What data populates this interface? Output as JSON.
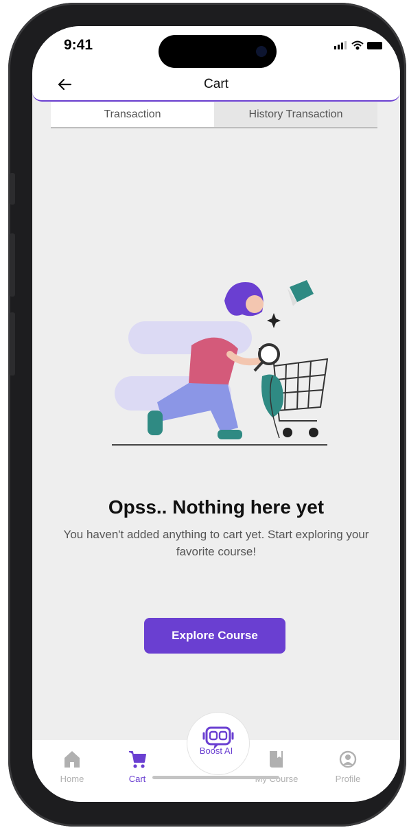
{
  "status_bar": {
    "time": "9:41"
  },
  "header": {
    "title": "Cart",
    "back_icon": "arrow-left-icon"
  },
  "tabs": [
    {
      "label": "Transaction",
      "active": true
    },
    {
      "label": "History Transaction",
      "active": false
    }
  ],
  "empty_state": {
    "heading": "Opss.. Nothing here yet",
    "description": "You haven't added anything to cart yet. Start exploring your favorite course!",
    "cta_label": "Explore Course"
  },
  "bottom_nav": {
    "items": [
      {
        "label": "Home",
        "icon": "home-icon",
        "active": false
      },
      {
        "label": "Cart",
        "icon": "cart-icon",
        "active": true
      },
      {
        "label": "Boost AI",
        "icon": "robot-icon",
        "active": false
      },
      {
        "label": "My Course",
        "icon": "book-icon",
        "active": false
      },
      {
        "label": "Profile",
        "icon": "profile-icon",
        "active": false
      }
    ]
  },
  "colors": {
    "accent": "#6a3fd1",
    "background": "#eeeeee",
    "inactive": "#b0b0b0"
  }
}
